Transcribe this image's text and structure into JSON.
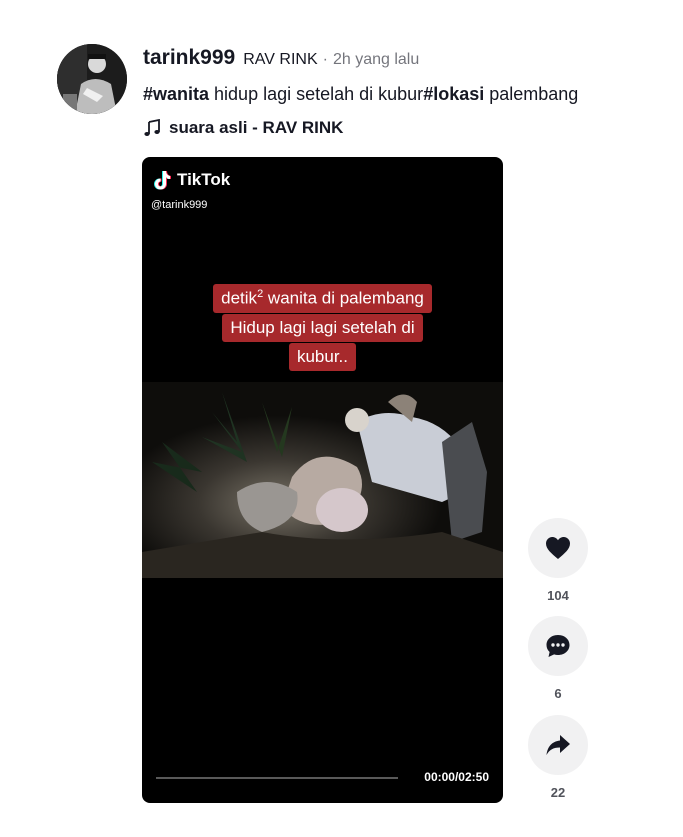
{
  "author": {
    "username": "tarink999",
    "nickname": "RAV RINK",
    "separator": "·",
    "time": "2h yang lalu"
  },
  "caption": {
    "tag1": "#wanita",
    "text1": " hidup lagi setelah di kubur",
    "tag2": "#lokasi",
    "text2": " palembang"
  },
  "music": {
    "icon": "music-note-icon",
    "title": "suara asli - RAV RINK"
  },
  "video": {
    "watermark_text": "TikTok",
    "watermark_handle": "@tarink999",
    "overlay": {
      "line1_prefix": "detik",
      "line1_sup": "2",
      "line1_suffix": " wanita di palembang",
      "line2": "Hidup lagi lagi setelah di",
      "line3": "kubur.."
    },
    "time": "00:00/02:50",
    "progress": 0
  },
  "actions": {
    "like": {
      "icon": "heart-icon",
      "count": "104"
    },
    "comment": {
      "icon": "comment-icon",
      "count": "6"
    },
    "share": {
      "icon": "share-icon",
      "count": "22"
    }
  },
  "colors": {
    "overlay_bg": "#a7292c",
    "action_bg": "#f1f1f2",
    "text": "#161823"
  }
}
